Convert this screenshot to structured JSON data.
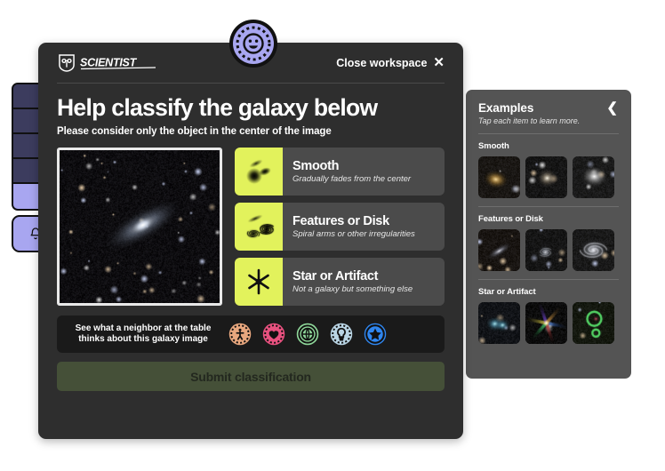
{
  "background": {
    "tiles": [
      {
        "name": "tile-1",
        "color": "#3c3c5e",
        "active": false
      },
      {
        "name": "tile-2",
        "color": "#3c3c5e",
        "active": false
      },
      {
        "name": "tile-3",
        "color": "#3c3c5e",
        "active": false
      },
      {
        "name": "tile-4",
        "color": "#3c3c5e",
        "active": false
      },
      {
        "name": "tile-5",
        "color": "#a8a6f0",
        "active": true
      }
    ],
    "notification_icon": "bell-icon"
  },
  "top_badge": {
    "icon": "smiley-face-badge-icon",
    "color": "#a8a6f0"
  },
  "modal": {
    "logo_text": "SCIENTIST",
    "logo_icon": "shield-scientist-logo",
    "close_label": "Close workspace",
    "close_icon": "close-x-icon",
    "title": "Help classify the galaxy below",
    "subtitle": "Please consider only the object in the center of the image",
    "galaxy_image_alt": "galaxy-subject-image",
    "options": [
      {
        "name": "Smooth",
        "description": "Gradually fades from the center",
        "icon": "smooth-galaxy-icon",
        "swatch_color": "#e2f25c"
      },
      {
        "name": "Features or Disk",
        "description": "Spiral arms or other irregularities",
        "icon": "spiral-disk-icon",
        "swatch_color": "#e2f25c"
      },
      {
        "name": "Star or Artifact",
        "description": "Not a galaxy but something else",
        "icon": "star-artifact-icon",
        "swatch_color": "#e2f25c"
      }
    ],
    "neighbor": {
      "line1": "See what a neighbor at the table",
      "line2": "thinks about this galaxy image",
      "avatars": [
        {
          "icon": "person-avatar-icon",
          "color": "#e8a77e"
        },
        {
          "icon": "heart-avatar-icon",
          "color": "#e8517f"
        },
        {
          "icon": "globe-avatar-icon",
          "color": "#8fd89a"
        },
        {
          "icon": "lightbulb-avatar-icon",
          "color": "#b9d4e4"
        },
        {
          "icon": "star-avatar-icon",
          "color": "#2f86f0"
        }
      ]
    },
    "submit_label": "Submit classification",
    "submit_color": "#455038"
  },
  "examples": {
    "title": "Examples",
    "subtitle": "Tap each item to learn more.",
    "collapse_icon": "chevron-left-icon",
    "groups": [
      {
        "label": "Smooth",
        "thumbs": [
          "smooth-example-1",
          "smooth-example-2",
          "smooth-example-3"
        ]
      },
      {
        "label": "Features or Disk",
        "thumbs": [
          "disk-example-1",
          "disk-example-2",
          "disk-example-3"
        ]
      },
      {
        "label": "Star or Artifact",
        "thumbs": [
          "artifact-example-1",
          "artifact-example-2",
          "artifact-example-3"
        ]
      }
    ]
  }
}
